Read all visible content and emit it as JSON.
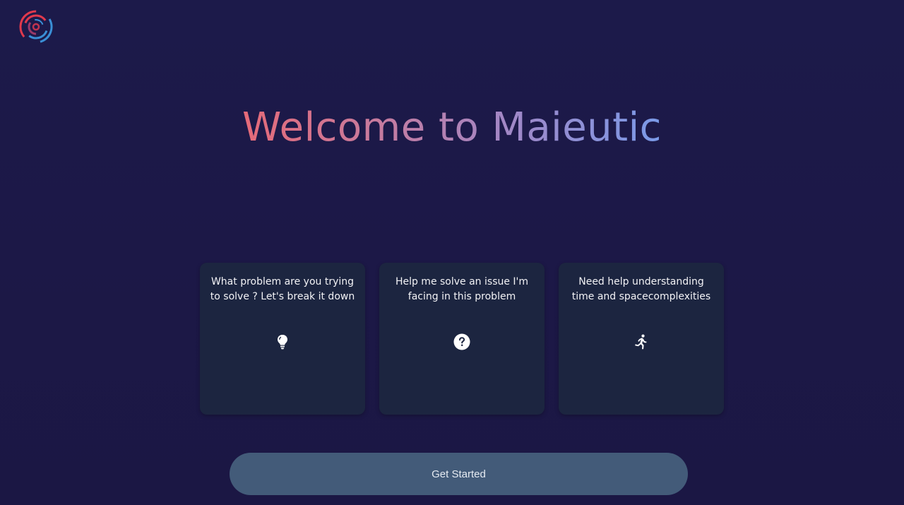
{
  "logo": {
    "icon": "swirl-logo-icon",
    "colors": [
      "#e0394d",
      "#3a8fd6"
    ]
  },
  "header": {
    "title": "Welcome to Maieutic"
  },
  "cards": [
    {
      "text": "What problem are you trying to solve ? Let's break it down",
      "icon": "lightbulb-icon"
    },
    {
      "text": "Help me solve an issue I'm facing in this problem",
      "icon": "question-circle-icon"
    },
    {
      "text": "Need help understanding time and spacecomplexities",
      "icon": "running-person-icon"
    }
  ],
  "cta": {
    "label": "Get Started"
  },
  "colors": {
    "background": "#1c1a4a",
    "card": "#1c2540",
    "button": "#435b79",
    "title_gradient_start": "#e56a78",
    "title_gradient_end": "#7a9ae8"
  }
}
